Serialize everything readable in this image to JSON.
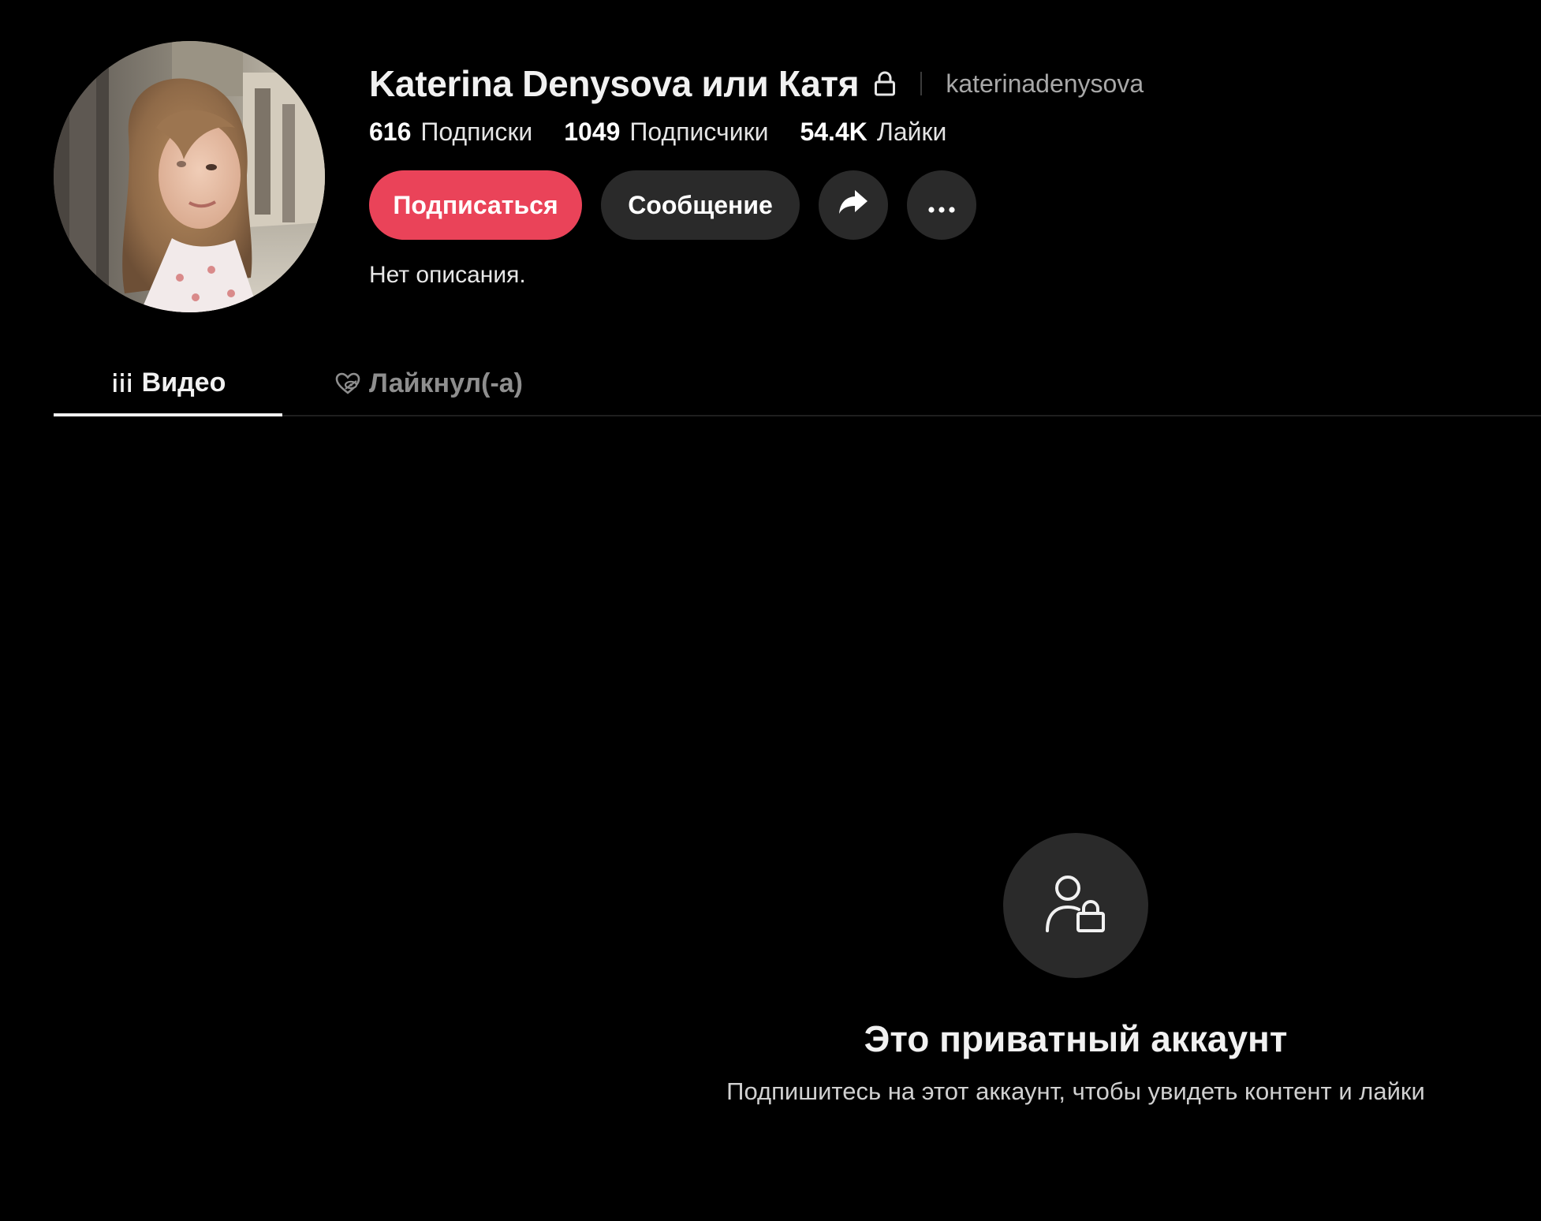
{
  "profile": {
    "display_name": "Katerina Denysova или Катя",
    "username": "katerinadenysova",
    "bio": "Нет описания.",
    "avatar_icon": "profile-photo"
  },
  "stats": [
    {
      "value": "616",
      "label": "Подписки"
    },
    {
      "value": "1049",
      "label": "Подписчики"
    },
    {
      "value": "54.4K",
      "label": "Лайки"
    }
  ],
  "actions": {
    "follow_label": "Подписаться",
    "message_label": "Сообщение",
    "share_icon": "share-arrow-icon",
    "more_icon": "more-dots-icon"
  },
  "tabs": [
    {
      "label": "Видео",
      "icon": "grid-bars-icon",
      "active": true
    },
    {
      "label": "Лайкнул(-а)",
      "icon": "heart-hidden-icon",
      "active": false
    }
  ],
  "private_notice": {
    "title": "Это приватный аккаунт",
    "subtitle": "Подпишитесь на этот аккаунт, чтобы увидеть контент и лайки",
    "icon": "user-lock-icon"
  },
  "colors": {
    "background": "#000000",
    "accent": "#ea4359",
    "button_dark": "#2a2a2a",
    "muted_text": "#a8a8a8"
  }
}
